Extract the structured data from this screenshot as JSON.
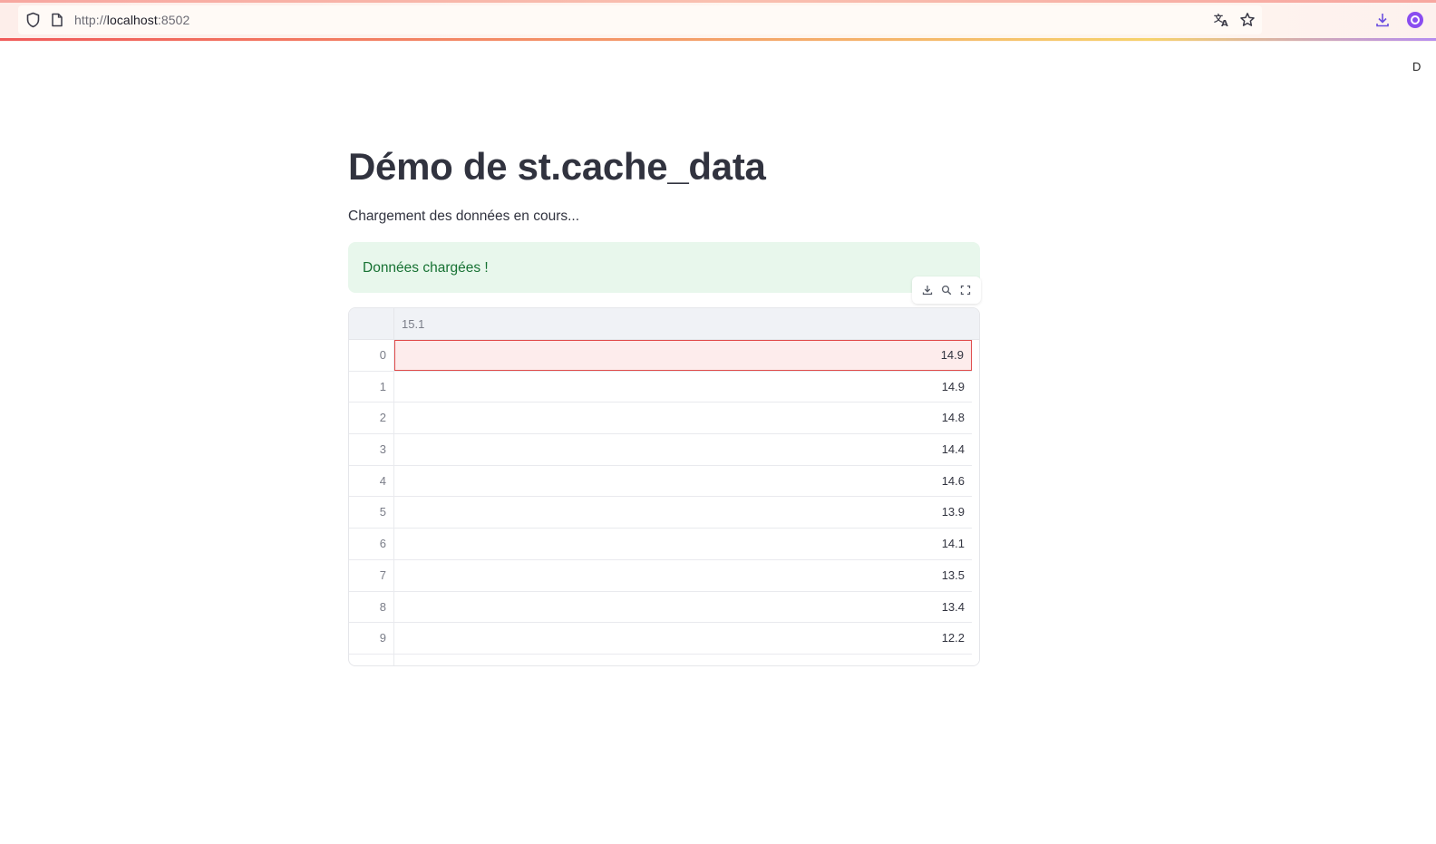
{
  "browser": {
    "url_scheme": "http://",
    "url_host": "localhost",
    "url_port": ":8502",
    "right_edge_text": "D",
    "icons": {
      "shield": "shield-icon",
      "page": "page-icon",
      "translate": "translate-icon",
      "bookmark": "star-icon",
      "download": "download-icon",
      "account": "account-icon"
    }
  },
  "page": {
    "title": "Démo de st.cache_data",
    "status_text": "Chargement des données en cours...",
    "success_message": "Données chargées !"
  },
  "dataframe": {
    "toolbar": {
      "download_icon": "download-icon",
      "search_icon": "search-icon",
      "fullscreen_icon": "fullscreen-icon"
    },
    "column_header": "15.1",
    "selected_row": 0,
    "rows": [
      {
        "index": "0",
        "value": "14.9"
      },
      {
        "index": "1",
        "value": "14.9"
      },
      {
        "index": "2",
        "value": "14.8"
      },
      {
        "index": "3",
        "value": "14.4"
      },
      {
        "index": "4",
        "value": "14.6"
      },
      {
        "index": "5",
        "value": "13.9"
      },
      {
        "index": "6",
        "value": "14.1"
      },
      {
        "index": "7",
        "value": "13.5"
      },
      {
        "index": "8",
        "value": "13.4"
      },
      {
        "index": "9",
        "value": "12.2"
      }
    ]
  },
  "colors": {
    "success_bg": "#e8f7ec",
    "success_text": "#177233",
    "selection_border": "#e04a4a",
    "selection_bg": "#fdecec",
    "header_bg": "#f0f2f6"
  }
}
